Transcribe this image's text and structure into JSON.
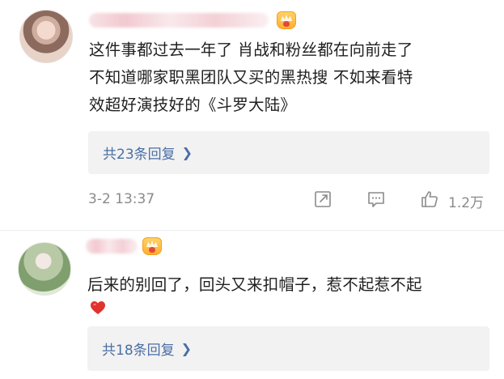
{
  "comments": [
    {
      "text_lines": [
        "这件事都过去一年了  肖战和粉丝都在向前走了",
        "不知道哪家职黑团队又买的黑热搜  不如来看特",
        "效超好演技好的《斗罗大陆》"
      ],
      "replies_label": "共23条回复",
      "timestamp": "3-2 13:37",
      "like_count": "1.2万",
      "icons": [
        "avatar",
        "vip-badge-icon",
        "chevron-right-icon",
        "share-icon",
        "comment-icon",
        "like-icon"
      ]
    },
    {
      "text_lines": [
        "后来的别回了，回头又来扣帽子，惹不起惹不起"
      ],
      "emoji": "red-heart-icon",
      "replies_label": "共18条回复",
      "icons": [
        "avatar",
        "vip-badge-icon",
        "red-heart-icon",
        "chevron-right-icon"
      ]
    }
  ],
  "colors": {
    "link": "#4a6fa5",
    "meta": "#8a8a8a",
    "reply_box": "#f2f2f2",
    "heart": "#e0332d",
    "vip_gold": "#ffae2e"
  }
}
